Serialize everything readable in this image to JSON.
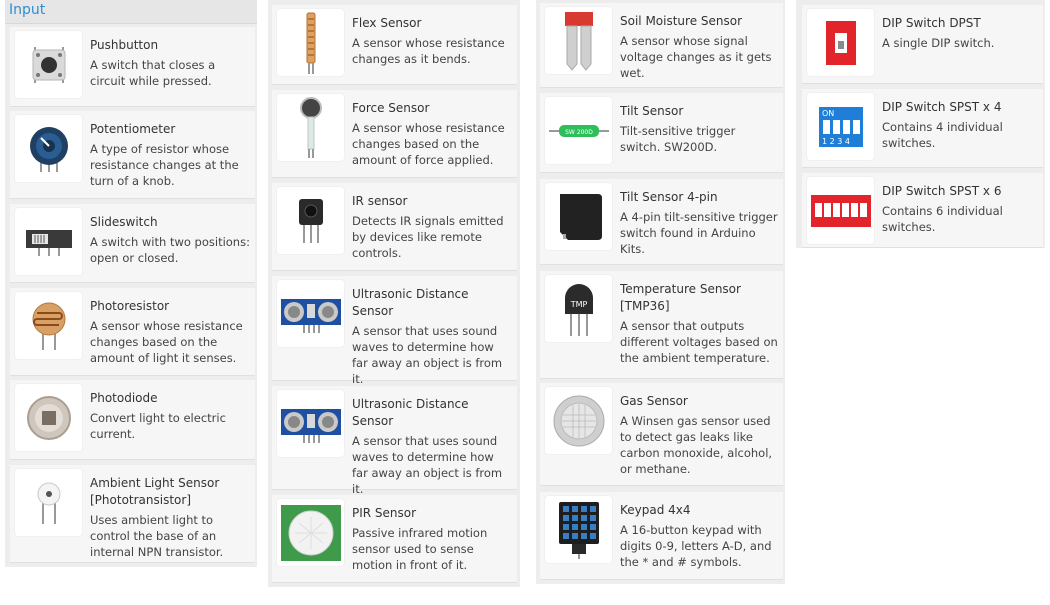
{
  "section": {
    "title": "Input"
  },
  "col1": [
    {
      "name": "Pushbutton",
      "desc": "A switch that closes a circuit while pressed.",
      "icon": "pushbutton-icon"
    },
    {
      "name": "Potentiometer",
      "desc": "A type of resistor whose resistance changes at the turn of a knob.",
      "icon": "potentiometer-icon"
    },
    {
      "name": "Slideswitch",
      "desc": "A switch with two positions: open or closed.",
      "icon": "slideswitch-icon"
    },
    {
      "name": "Photoresistor",
      "desc": "A sensor whose resistance changes based on the amount of light it senses.",
      "icon": "photoresistor-icon"
    },
    {
      "name": "Photodiode",
      "desc": "Convert light to electric current.",
      "icon": "photodiode-icon"
    },
    {
      "name": "Ambient Light Sensor [Phototransistor]",
      "desc": "Uses ambient light to control the base of an internal NPN transistor.",
      "icon": "phototransistor-icon"
    }
  ],
  "col2": [
    {
      "name": "Flex Sensor",
      "desc": "A sensor whose resistance changes as it bends.",
      "icon": "flex-sensor-icon"
    },
    {
      "name": "Force Sensor",
      "desc": "A sensor whose resistance changes based on the amount of force applied.",
      "icon": "force-sensor-icon"
    },
    {
      "name": "IR sensor",
      "desc": "Detects IR signals emitted by devices like remote controls.",
      "icon": "ir-sensor-icon"
    },
    {
      "name": "Ultrasonic Distance Sensor",
      "desc": "A sensor that uses sound waves to determine how far away an object is from it.",
      "icon": "ultrasonic-sensor-icon"
    },
    {
      "name": "Ultrasonic Distance Sensor",
      "desc": "A sensor that uses sound waves to determine how far away an object is from it.",
      "icon": "ultrasonic-sensor-icon"
    },
    {
      "name": "PIR Sensor",
      "desc": "Passive infrared motion sensor used to sense motion in front of it.",
      "icon": "pir-sensor-icon"
    }
  ],
  "col3": [
    {
      "name": "Soil Moisture Sensor",
      "desc": "A sensor whose signal voltage changes as it gets wet.",
      "icon": "soil-moisture-icon"
    },
    {
      "name": "Tilt Sensor",
      "desc": "Tilt-sensitive trigger switch. SW200D.",
      "icon": "tilt-sensor-icon",
      "chip": "SW 200D"
    },
    {
      "name": "Tilt Sensor 4-pin",
      "desc": "A 4-pin tilt-sensitive trigger switch found in Arduino Kits.",
      "icon": "tilt-sensor-4pin-icon"
    },
    {
      "name": "Temperature Sensor [TMP36]",
      "desc": "A sensor that outputs different voltages based on the ambient temperature.",
      "icon": "temperature-sensor-icon",
      "chip": "TMP"
    },
    {
      "name": "Gas Sensor",
      "desc": "A Winsen gas sensor used to detect gas leaks like carbon monoxide, alcohol, or methane.",
      "icon": "gas-sensor-icon"
    },
    {
      "name": "Keypad 4x4",
      "desc": "A 16-button keypad with digits 0-9, letters A-D, and the * and # symbols.",
      "icon": "keypad-icon"
    }
  ],
  "col4": [
    {
      "name": "DIP Switch DPST",
      "desc": "A single DIP switch.",
      "icon": "dip-switch-dpst-icon"
    },
    {
      "name": "DIP Switch SPST x 4",
      "desc": "Contains 4 individual switches.",
      "icon": "dip-switch-4-icon",
      "on_label": "ON",
      "digits": "1 2 3 4"
    },
    {
      "name": "DIP Switch SPST x 6",
      "desc": "Contains 6 individual switches.",
      "icon": "dip-switch-6-icon"
    }
  ]
}
